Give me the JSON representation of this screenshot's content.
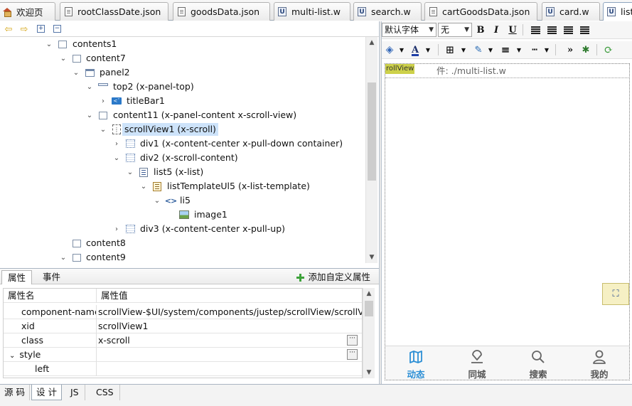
{
  "tabs": [
    {
      "label": "欢迎页",
      "icon": "home-icon",
      "active": false
    },
    {
      "label": "rootClassDate.json",
      "icon": "json-file-icon",
      "active": false
    },
    {
      "label": "goodsData.json",
      "icon": "json-file-icon",
      "active": false
    },
    {
      "label": "multi-list.w",
      "icon": "ui-file-icon",
      "active": false
    },
    {
      "label": "search.w",
      "icon": "ui-file-icon",
      "active": false
    },
    {
      "label": "cartGoodsData.json",
      "icon": "json-file-icon",
      "active": false
    },
    {
      "label": "card.w",
      "icon": "ui-file-icon",
      "active": false
    },
    {
      "label": "list",
      "icon": "ui-file-icon",
      "active": true
    }
  ],
  "outline": {
    "nodes": [
      {
        "label": "contents1",
        "icon": "panel-icon",
        "expanded": true
      },
      {
        "label": "content7",
        "icon": "box-icon",
        "expanded": true
      },
      {
        "label": "panel2",
        "icon": "panel-icon",
        "expanded": true
      },
      {
        "label": "top2 (x-panel-top)",
        "icon": "panel-top-icon",
        "expanded": true
      },
      {
        "label": "titleBar1",
        "icon": "titlebar-icon",
        "expanded": false
      },
      {
        "label": "content11 (x-panel-content  x-scroll-view)",
        "icon": "box-icon",
        "expanded": true
      },
      {
        "label": "scrollView1 (x-scroll)",
        "icon": "scroll-icon",
        "expanded": true,
        "selected": true
      },
      {
        "label": "div1 (x-content-center x-pull-down container)",
        "icon": "div-icon",
        "expanded": false
      },
      {
        "label": "div2 (x-scroll-content)",
        "icon": "div-icon",
        "expanded": true
      },
      {
        "label": "list5 (x-list)",
        "icon": "list-icon",
        "expanded": true
      },
      {
        "label": "listTemplateUl5 (x-list-template)",
        "icon": "template-icon",
        "expanded": true
      },
      {
        "label": "li5",
        "icon": "code-icon",
        "expanded": true
      },
      {
        "label": "image1",
        "icon": "image-icon"
      },
      {
        "label": "div3 (x-content-center x-pull-up)",
        "icon": "div-icon",
        "expanded": false
      },
      {
        "label": "content8",
        "icon": "box-icon"
      },
      {
        "label": "content9",
        "icon": "box-icon",
        "expanded": true
      }
    ]
  },
  "props": {
    "tab_properties": "属性",
    "tab_events": "事件",
    "add_custom": "添加自定义属性",
    "col_name": "属性名",
    "col_value": "属性值",
    "rows": [
      {
        "name": "component-name",
        "value": "scrollView-$UI/system/components/justep/scrollView/scrollView"
      },
      {
        "name": "xid",
        "value": "scrollView1"
      },
      {
        "name": "class",
        "value": "x-scroll"
      },
      {
        "name": "style",
        "value": ""
      },
      {
        "name": "left",
        "value": ""
      }
    ]
  },
  "bottom_tabs": [
    {
      "label": "源 码",
      "active": false
    },
    {
      "label": "设 计",
      "active": true
    },
    {
      "label": "JS",
      "active": false
    },
    {
      "label": "CSS",
      "active": false
    }
  ],
  "format_toolbar": {
    "font_select": "默认字体",
    "size_select": "无",
    "bold": "B",
    "italic": "I",
    "underline": "U"
  },
  "designer": {
    "badge": "rollView",
    "include_label": "件:  ./multi-list.w",
    "nav_items": [
      {
        "label": "动态",
        "icon": "map-icon",
        "active": true
      },
      {
        "label": "同城",
        "icon": "location-icon",
        "active": false
      },
      {
        "label": "搜索",
        "icon": "search-icon",
        "active": false
      },
      {
        "label": "我的",
        "icon": "user-icon",
        "active": false
      }
    ]
  },
  "colors": {
    "accent": "#2d8fd5",
    "selection": "#cde3fa",
    "badge": "#cdd14a"
  }
}
